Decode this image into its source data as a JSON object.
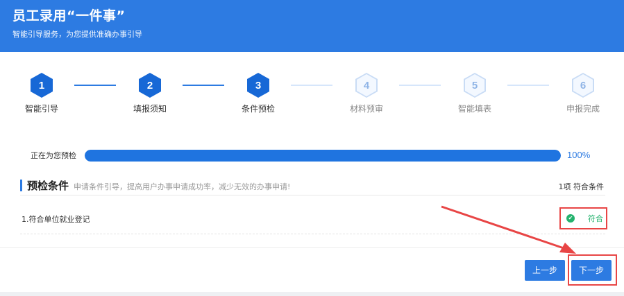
{
  "header": {
    "title": "员工录用“一件事”",
    "subtitle": "智能引导服务，为您提供准确办事引导"
  },
  "steps": [
    {
      "num": "1",
      "label": "智能引导",
      "state": "done"
    },
    {
      "num": "2",
      "label": "填报须知",
      "state": "done"
    },
    {
      "num": "3",
      "label": "条件预检",
      "state": "done"
    },
    {
      "num": "4",
      "label": "材料预审",
      "state": "todo"
    },
    {
      "num": "5",
      "label": "智能填表",
      "state": "todo"
    },
    {
      "num": "6",
      "label": "申报完成",
      "state": "todo"
    }
  ],
  "progress": {
    "label": "正在为您预检",
    "percent_text": "100%",
    "value": 1.0
  },
  "section": {
    "title": "预检条件",
    "description": "申请条件引导，提高用户办事申请成功率，减少无效的办事申请!",
    "count": "1项 符合条件"
  },
  "conditions": [
    {
      "text": "1.符合单位就业登记",
      "status": "符合",
      "status_icon": "check-circle-icon"
    }
  ],
  "buttons": {
    "prev": "上一步",
    "next": "下一步"
  },
  "colors": {
    "primary": "#2d7be2",
    "success": "#23b26d",
    "annotation": "#e84545"
  }
}
